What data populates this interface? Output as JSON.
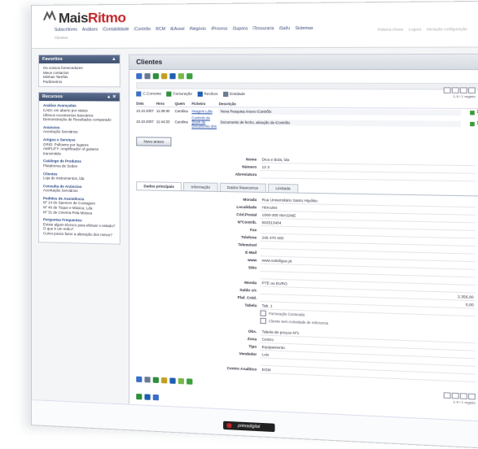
{
  "app": {
    "logo_main": "Mais",
    "logo_accent": "Ritmo",
    "brand_color": "#c3262b"
  },
  "topnav": {
    "items": [
      "Subscritores",
      "Análises",
      "iContabilidade",
      "iContrôlo",
      "RCM",
      "iEAcesl",
      "iNegócio",
      "iProcess",
      "iSupora",
      "iTesouraria",
      "iSal/u",
      "Sistemas"
    ],
    "sub": "Clientes",
    "user": [
      "Palavra-chave",
      "Logout",
      "Iniciação configuração"
    ]
  },
  "sidebar": {
    "box1": {
      "title": "Favoritos",
      "items": [
        "Os vossos fornecedores",
        "Meus contactos",
        "Minhas Tarefas",
        "Parâmetros"
      ]
    },
    "box2": {
      "title": "Recursos",
      "groups": [
        {
          "title": "Análise Avançadas",
          "items": [
            "CADI: em aberto por status",
            "Últimos movimentos bancários",
            "Demonstração de Resultados comparado"
          ]
        },
        {
          "title": "Anúncios",
          "items": [
            "Acentação Serviários"
          ]
        },
        {
          "title": "Artigos e Serviços",
          "items": [
            "GRID: Pullowns por lugares",
            "AMPLIFY: Amplificador of guitarra transmitido"
          ]
        },
        {
          "title": "Catálogo de Produtos",
          "items": [
            "Plataforma de Sedes"
          ]
        },
        {
          "title": "Clientes",
          "items": [
            "Loja de instrumentos, lda"
          ]
        },
        {
          "title": "Consulta de Anúncios",
          "items": [
            "Acentação Serviários"
          ]
        },
        {
          "title": "Pedidos de Assistência",
          "items": [
            "Nº 14 do Spencer de Contagem",
            "Nº 40 de Toque e Música, Lda",
            "Nº 31 de Cinema Pela Música"
          ]
        },
        {
          "title": "Perguntas Frequentes",
          "items": [
            "Existe algum técnico para efetuar o estado?",
            "O que é um reiho?",
            "Como posso fazer a alteração dos meios?"
          ]
        }
      ]
    }
  },
  "main": {
    "title": "Clientes",
    "legend": [
      "C.Corrente",
      "Facturação",
      "Recibos",
      "Entidade"
    ],
    "pager_text": "1-9 / 1 registo",
    "obs_headers": [
      "Data",
      "Hora",
      "Quem",
      "Ficheiro",
      "Descrição",
      ""
    ],
    "obs_rows": [
      {
        "date": "10.10.2007",
        "time": "11:39:30",
        "who": "Carolina",
        "file": "Imagem.Ldla",
        "desc": "Nova Pesquisa Anexo iContrôlo"
      },
      {
        "date": "10.10.2007",
        "time": "11:44:33",
        "who": "Carolina",
        "file": "Controlo de Stock de Documento dos",
        "desc": "Documento de fecho, ativação da iContrôlo"
      }
    ],
    "new_button": "Novo anexo",
    "header_fields": [
      {
        "label": "Nome",
        "value": "Dica e Bola, lda"
      },
      {
        "label": "Número",
        "value": "12   3"
      },
      {
        "label": "Abreviatura",
        "value": ""
      }
    ],
    "tabs": [
      "Dados principais",
      "Informação",
      "Dados financeiros",
      "Limitada"
    ],
    "fields": [
      {
        "label": "Morada",
        "value": "Rua Universitário Santo Hipólito"
      },
      {
        "label": "Localidade",
        "value": "Hércules"
      },
      {
        "label": "Cód.Postal",
        "value": "1000-300 IMAGINE"
      },
      {
        "label": "NºContrib.",
        "value": "502513404"
      },
      {
        "label": "Fax",
        "value": ""
      },
      {
        "label": "Telefone",
        "value": "245 470 400"
      },
      {
        "label": "Telemóvel",
        "value": ""
      },
      {
        "label": "E-Mail",
        "value": ""
      },
      {
        "label": "www",
        "value": "www.soleiligue.pt"
      },
      {
        "label": "Sítio",
        "value": ""
      },
      {
        "label": "",
        "value": ""
      },
      {
        "label": "Moeda",
        "value": "PTE ou EURO"
      },
      {
        "label": "Saldo c/c",
        "value": "2.356,00",
        "align": "right"
      },
      {
        "label": "Plaf. Créd.",
        "value": "0,00",
        "align": "right"
      },
      {
        "label": "Tabela",
        "value": "Tab. 1"
      }
    ],
    "checkboxes": [
      "Facturação Conseada",
      "Cliente sem Actividade de referencia"
    ],
    "fields2": [
      {
        "label": "Obs.",
        "value": "Tabela de preços Nº1"
      },
      {
        "label": "Zona",
        "value": "Centro"
      },
      {
        "label": "Tipo",
        "value": "Equipamento"
      },
      {
        "label": "Vendedor",
        "value": "Luis"
      },
      {
        "label": "",
        "value": ""
      },
      {
        "label": "Centro Analítico",
        "value": "EGM"
      }
    ],
    "bottom_pager": "1-9 / 1 registo"
  },
  "footer": {
    "brand": "primadigital"
  }
}
